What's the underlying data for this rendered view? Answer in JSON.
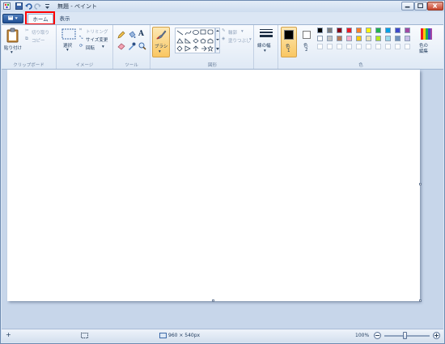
{
  "window": {
    "title": "無題 - ペイント"
  },
  "tabs": [
    {
      "label": "ホーム"
    },
    {
      "label": "表示"
    }
  ],
  "ribbon": {
    "clipboard": {
      "group_label": "クリップボード",
      "paste": "貼り付け",
      "cut": "切り取り",
      "copy": "コピー"
    },
    "image": {
      "group_label": "イメージ",
      "select": "選択",
      "crop": "トリミング",
      "resize": "サイズ変更",
      "rotate": "回転"
    },
    "tools": {
      "group_label": "ツール"
    },
    "brush": {
      "label": "ブラシ"
    },
    "shapes": {
      "group_label": "図形",
      "outline": "輪郭",
      "fill": "塗りつぶし"
    },
    "size": {
      "label": "線の幅"
    },
    "colors": {
      "group_label": "色",
      "color1_label": "色",
      "color1_num": "1",
      "color2_label": "色",
      "color2_num": "2",
      "edit_label_1": "色の",
      "edit_label_2": "編集",
      "color1_value": "#000000",
      "color2_value": "#ffffff",
      "palette_row1": [
        "#000000",
        "#7f7f7f",
        "#880015",
        "#ed1c24",
        "#ff7f27",
        "#fff200",
        "#22b14c",
        "#00a2e8",
        "#3f48cc",
        "#a349a4"
      ],
      "palette_row2": [
        "#ffffff",
        "#c3c3c3",
        "#b97a57",
        "#ffaec9",
        "#ffc90e",
        "#efe4b0",
        "#b5e61d",
        "#99d9ea",
        "#7092be",
        "#c8bfe7"
      ]
    }
  },
  "status": {
    "dimensions": "960 × 540px",
    "zoom": "100%"
  }
}
